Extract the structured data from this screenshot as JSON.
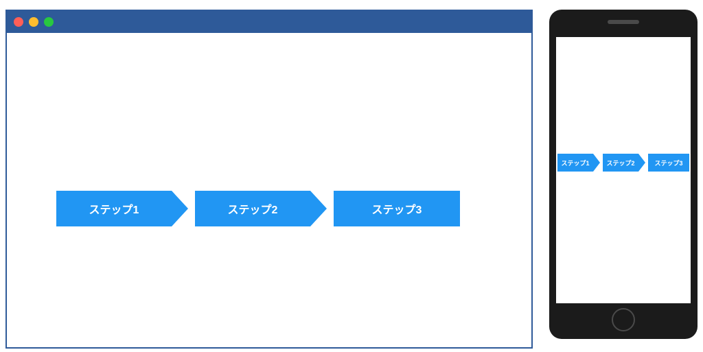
{
  "colors": {
    "brand_blue": "#2e5a99",
    "step_blue": "#2196f3",
    "phone_frame": "#1b1b1b",
    "traffic_red": "#ff5f57",
    "traffic_yellow": "#ffbd2e",
    "traffic_green": "#28c840"
  },
  "pc": {
    "steps": [
      {
        "label": "ステップ1"
      },
      {
        "label": "ステップ2"
      },
      {
        "label": "ステップ3"
      }
    ]
  },
  "sp": {
    "steps": [
      {
        "label": "ステップ1"
      },
      {
        "label": "ステップ2"
      },
      {
        "label": "ステップ3"
      }
    ]
  }
}
